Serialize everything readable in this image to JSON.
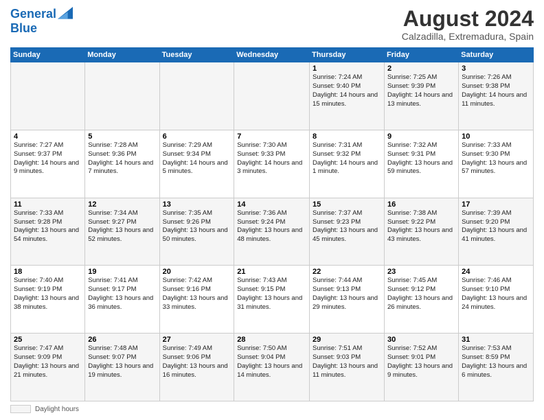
{
  "header": {
    "logo_line1": "General",
    "logo_line2": "Blue",
    "main_title": "August 2024",
    "subtitle": "Calzadilla, Extremadura, Spain"
  },
  "days_of_week": [
    "Sunday",
    "Monday",
    "Tuesday",
    "Wednesday",
    "Thursday",
    "Friday",
    "Saturday"
  ],
  "weeks": [
    [
      {
        "num": "",
        "info": ""
      },
      {
        "num": "",
        "info": ""
      },
      {
        "num": "",
        "info": ""
      },
      {
        "num": "",
        "info": ""
      },
      {
        "num": "1",
        "info": "Sunrise: 7:24 AM\nSunset: 9:40 PM\nDaylight: 14 hours\nand 15 minutes."
      },
      {
        "num": "2",
        "info": "Sunrise: 7:25 AM\nSunset: 9:39 PM\nDaylight: 14 hours\nand 13 minutes."
      },
      {
        "num": "3",
        "info": "Sunrise: 7:26 AM\nSunset: 9:38 PM\nDaylight: 14 hours\nand 11 minutes."
      }
    ],
    [
      {
        "num": "4",
        "info": "Sunrise: 7:27 AM\nSunset: 9:37 PM\nDaylight: 14 hours\nand 9 minutes."
      },
      {
        "num": "5",
        "info": "Sunrise: 7:28 AM\nSunset: 9:36 PM\nDaylight: 14 hours\nand 7 minutes."
      },
      {
        "num": "6",
        "info": "Sunrise: 7:29 AM\nSunset: 9:34 PM\nDaylight: 14 hours\nand 5 minutes."
      },
      {
        "num": "7",
        "info": "Sunrise: 7:30 AM\nSunset: 9:33 PM\nDaylight: 14 hours\nand 3 minutes."
      },
      {
        "num": "8",
        "info": "Sunrise: 7:31 AM\nSunset: 9:32 PM\nDaylight: 14 hours\nand 1 minute."
      },
      {
        "num": "9",
        "info": "Sunrise: 7:32 AM\nSunset: 9:31 PM\nDaylight: 13 hours\nand 59 minutes."
      },
      {
        "num": "10",
        "info": "Sunrise: 7:33 AM\nSunset: 9:30 PM\nDaylight: 13 hours\nand 57 minutes."
      }
    ],
    [
      {
        "num": "11",
        "info": "Sunrise: 7:33 AM\nSunset: 9:28 PM\nDaylight: 13 hours\nand 54 minutes."
      },
      {
        "num": "12",
        "info": "Sunrise: 7:34 AM\nSunset: 9:27 PM\nDaylight: 13 hours\nand 52 minutes."
      },
      {
        "num": "13",
        "info": "Sunrise: 7:35 AM\nSunset: 9:26 PM\nDaylight: 13 hours\nand 50 minutes."
      },
      {
        "num": "14",
        "info": "Sunrise: 7:36 AM\nSunset: 9:24 PM\nDaylight: 13 hours\nand 48 minutes."
      },
      {
        "num": "15",
        "info": "Sunrise: 7:37 AM\nSunset: 9:23 PM\nDaylight: 13 hours\nand 45 minutes."
      },
      {
        "num": "16",
        "info": "Sunrise: 7:38 AM\nSunset: 9:22 PM\nDaylight: 13 hours\nand 43 minutes."
      },
      {
        "num": "17",
        "info": "Sunrise: 7:39 AM\nSunset: 9:20 PM\nDaylight: 13 hours\nand 41 minutes."
      }
    ],
    [
      {
        "num": "18",
        "info": "Sunrise: 7:40 AM\nSunset: 9:19 PM\nDaylight: 13 hours\nand 38 minutes."
      },
      {
        "num": "19",
        "info": "Sunrise: 7:41 AM\nSunset: 9:17 PM\nDaylight: 13 hours\nand 36 minutes."
      },
      {
        "num": "20",
        "info": "Sunrise: 7:42 AM\nSunset: 9:16 PM\nDaylight: 13 hours\nand 33 minutes."
      },
      {
        "num": "21",
        "info": "Sunrise: 7:43 AM\nSunset: 9:15 PM\nDaylight: 13 hours\nand 31 minutes."
      },
      {
        "num": "22",
        "info": "Sunrise: 7:44 AM\nSunset: 9:13 PM\nDaylight: 13 hours\nand 29 minutes."
      },
      {
        "num": "23",
        "info": "Sunrise: 7:45 AM\nSunset: 9:12 PM\nDaylight: 13 hours\nand 26 minutes."
      },
      {
        "num": "24",
        "info": "Sunrise: 7:46 AM\nSunset: 9:10 PM\nDaylight: 13 hours\nand 24 minutes."
      }
    ],
    [
      {
        "num": "25",
        "info": "Sunrise: 7:47 AM\nSunset: 9:09 PM\nDaylight: 13 hours\nand 21 minutes."
      },
      {
        "num": "26",
        "info": "Sunrise: 7:48 AM\nSunset: 9:07 PM\nDaylight: 13 hours\nand 19 minutes."
      },
      {
        "num": "27",
        "info": "Sunrise: 7:49 AM\nSunset: 9:06 PM\nDaylight: 13 hours\nand 16 minutes."
      },
      {
        "num": "28",
        "info": "Sunrise: 7:50 AM\nSunset: 9:04 PM\nDaylight: 13 hours\nand 14 minutes."
      },
      {
        "num": "29",
        "info": "Sunrise: 7:51 AM\nSunset: 9:03 PM\nDaylight: 13 hours\nand 11 minutes."
      },
      {
        "num": "30",
        "info": "Sunrise: 7:52 AM\nSunset: 9:01 PM\nDaylight: 13 hours\nand 9 minutes."
      },
      {
        "num": "31",
        "info": "Sunrise: 7:53 AM\nSunset: 8:59 PM\nDaylight: 13 hours\nand 6 minutes."
      }
    ]
  ],
  "footer": {
    "label": "Daylight hours"
  }
}
